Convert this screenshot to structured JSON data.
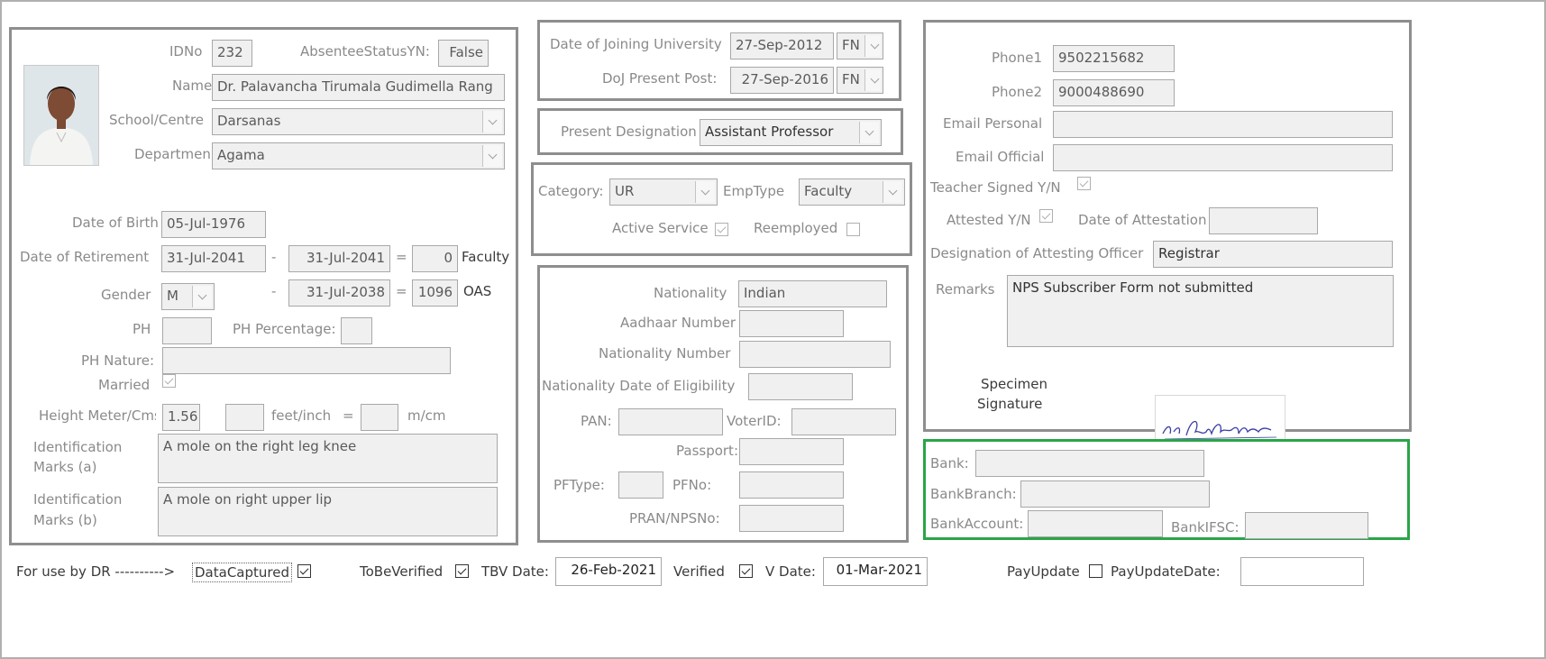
{
  "personal": {
    "idno_label": "IDNo",
    "idno": "232",
    "absentee_label": "AbsenteeStatusYN:",
    "absentee": "False",
    "name_label": "Name",
    "name": "Dr. Palavancha Tirumala Gudimella Rang",
    "school_label": "School/Centre",
    "school": "Darsanas",
    "department_label": "Departmen",
    "department": "Agama",
    "dob_label": "Date of Birth",
    "dob": "05-Jul-1976",
    "retirement_label": "Date of Retirement",
    "retirement": "31-Jul-2041",
    "dash1": "-",
    "ret_faculty_date": "31-Jul-2041",
    "eq1": "=",
    "ret_faculty_days": "0",
    "ret_faculty_label": "Faculty",
    "gender_label": "Gender",
    "gender": "M",
    "dash2": "-",
    "ret_oas_date": "31-Jul-2038",
    "eq2": "=",
    "ret_oas_days": "1096",
    "ret_oas_label": "OAS",
    "ph_label": "PH",
    "ph": "",
    "ph_pct_label": "PH Percentage:",
    "ph_pct": "",
    "ph_nature_label": "PH Nature:",
    "ph_nature": "",
    "married_label": "Married",
    "height_label": "Height Meter/Cms",
    "height": "1.56",
    "height_ft": "",
    "feet_inch_label": "feet/inch",
    "eq3": "=",
    "height_m": "",
    "mcm_label": "m/cm",
    "id_marks_a_label_1": "Identification",
    "id_marks_a_label_2": "Marks (a)",
    "id_marks_a": "A mole on the right leg knee",
    "id_marks_b_label_1": "Identification",
    "id_marks_b_label_2": "Marks (b)",
    "id_marks_b": "A mole on right upper lip"
  },
  "joining": {
    "doj_univ_label": "Date of Joining University",
    "doj_univ": "27-Sep-2012",
    "doj_univ_session": "FN",
    "doj_post_label": "DoJ Present Post:",
    "doj_post": "27-Sep-2016",
    "doj_post_session": "FN"
  },
  "designation": {
    "label": "Present Designation",
    "value": "Assistant Professor"
  },
  "category": {
    "category_label": "Category:",
    "category": "UR",
    "emptype_label": "EmpType",
    "emptype": "Faculty",
    "active_label": "Active Service",
    "reemployed_label": "Reemployed"
  },
  "nationality": {
    "nationality_label": "Nationality",
    "nationality": "Indian",
    "aadhaar_label": "Aadhaar Number",
    "aadhaar": "",
    "nat_number_label": "Nationality Number",
    "nat_number": "",
    "nat_date_label": "Nationality Date of Eligibility",
    "nat_date": "",
    "pan_label": "PAN:",
    "pan": "",
    "voter_label": "VoterID:",
    "voter": "",
    "passport_label": "Passport:",
    "passport": "",
    "pftype_label": "PFType:",
    "pftype": "",
    "pfno_label": "PFNo:",
    "pfno": "",
    "pran_label": "PRAN/NPSNo:",
    "pran": ""
  },
  "contact": {
    "phone1_label": "Phone1",
    "phone1": "9502215682",
    "phone2_label": "Phone2",
    "phone2": "9000488690",
    "email_personal_label": "Email Personal",
    "email_personal": "",
    "email_official_label": "Email Official",
    "email_official": "",
    "teacher_signed_label": "Teacher Signed Y/N",
    "attested_label": "Attested Y/N",
    "attestation_date_label": "Date of Attestation",
    "attestation_date": "",
    "attesting_officer_label": "Designation of Attesting Officer",
    "attesting_officer": "Registrar",
    "remarks_label": "Remarks",
    "remarks": "NPS Subscriber Form not submitted",
    "specimen_label_1": "Specimen",
    "specimen_label_2": "Signature",
    "signature_text": "Ph. RangaRaghavan"
  },
  "bank": {
    "bank_label": "Bank:",
    "bank": "",
    "branch_label": "BankBranch:",
    "branch": "",
    "account_label": "BankAccount:",
    "account": "",
    "ifsc_label": "BankIFSC:",
    "ifsc": ""
  },
  "footer": {
    "dr_label": "For use by DR ---------->",
    "data_captured_label": "DataCaptured",
    "to_be_verified_label": "ToBeVerified",
    "tbv_date_label": "TBV Date:",
    "tbv_date": "26-Feb-2021",
    "verified_label": "Verified",
    "v_date_label": "V Date:",
    "v_date": "01-Mar-2021",
    "pay_update_label": "PayUpdate",
    "pay_update_date_label": "PayUpdateDate:",
    "pay_update_date": ""
  },
  "colors": {
    "group_border": "#8e8e8e",
    "bank_border": "#2aa548",
    "field_bg": "#f0f0f0",
    "label_text": "#8a8a8a"
  }
}
